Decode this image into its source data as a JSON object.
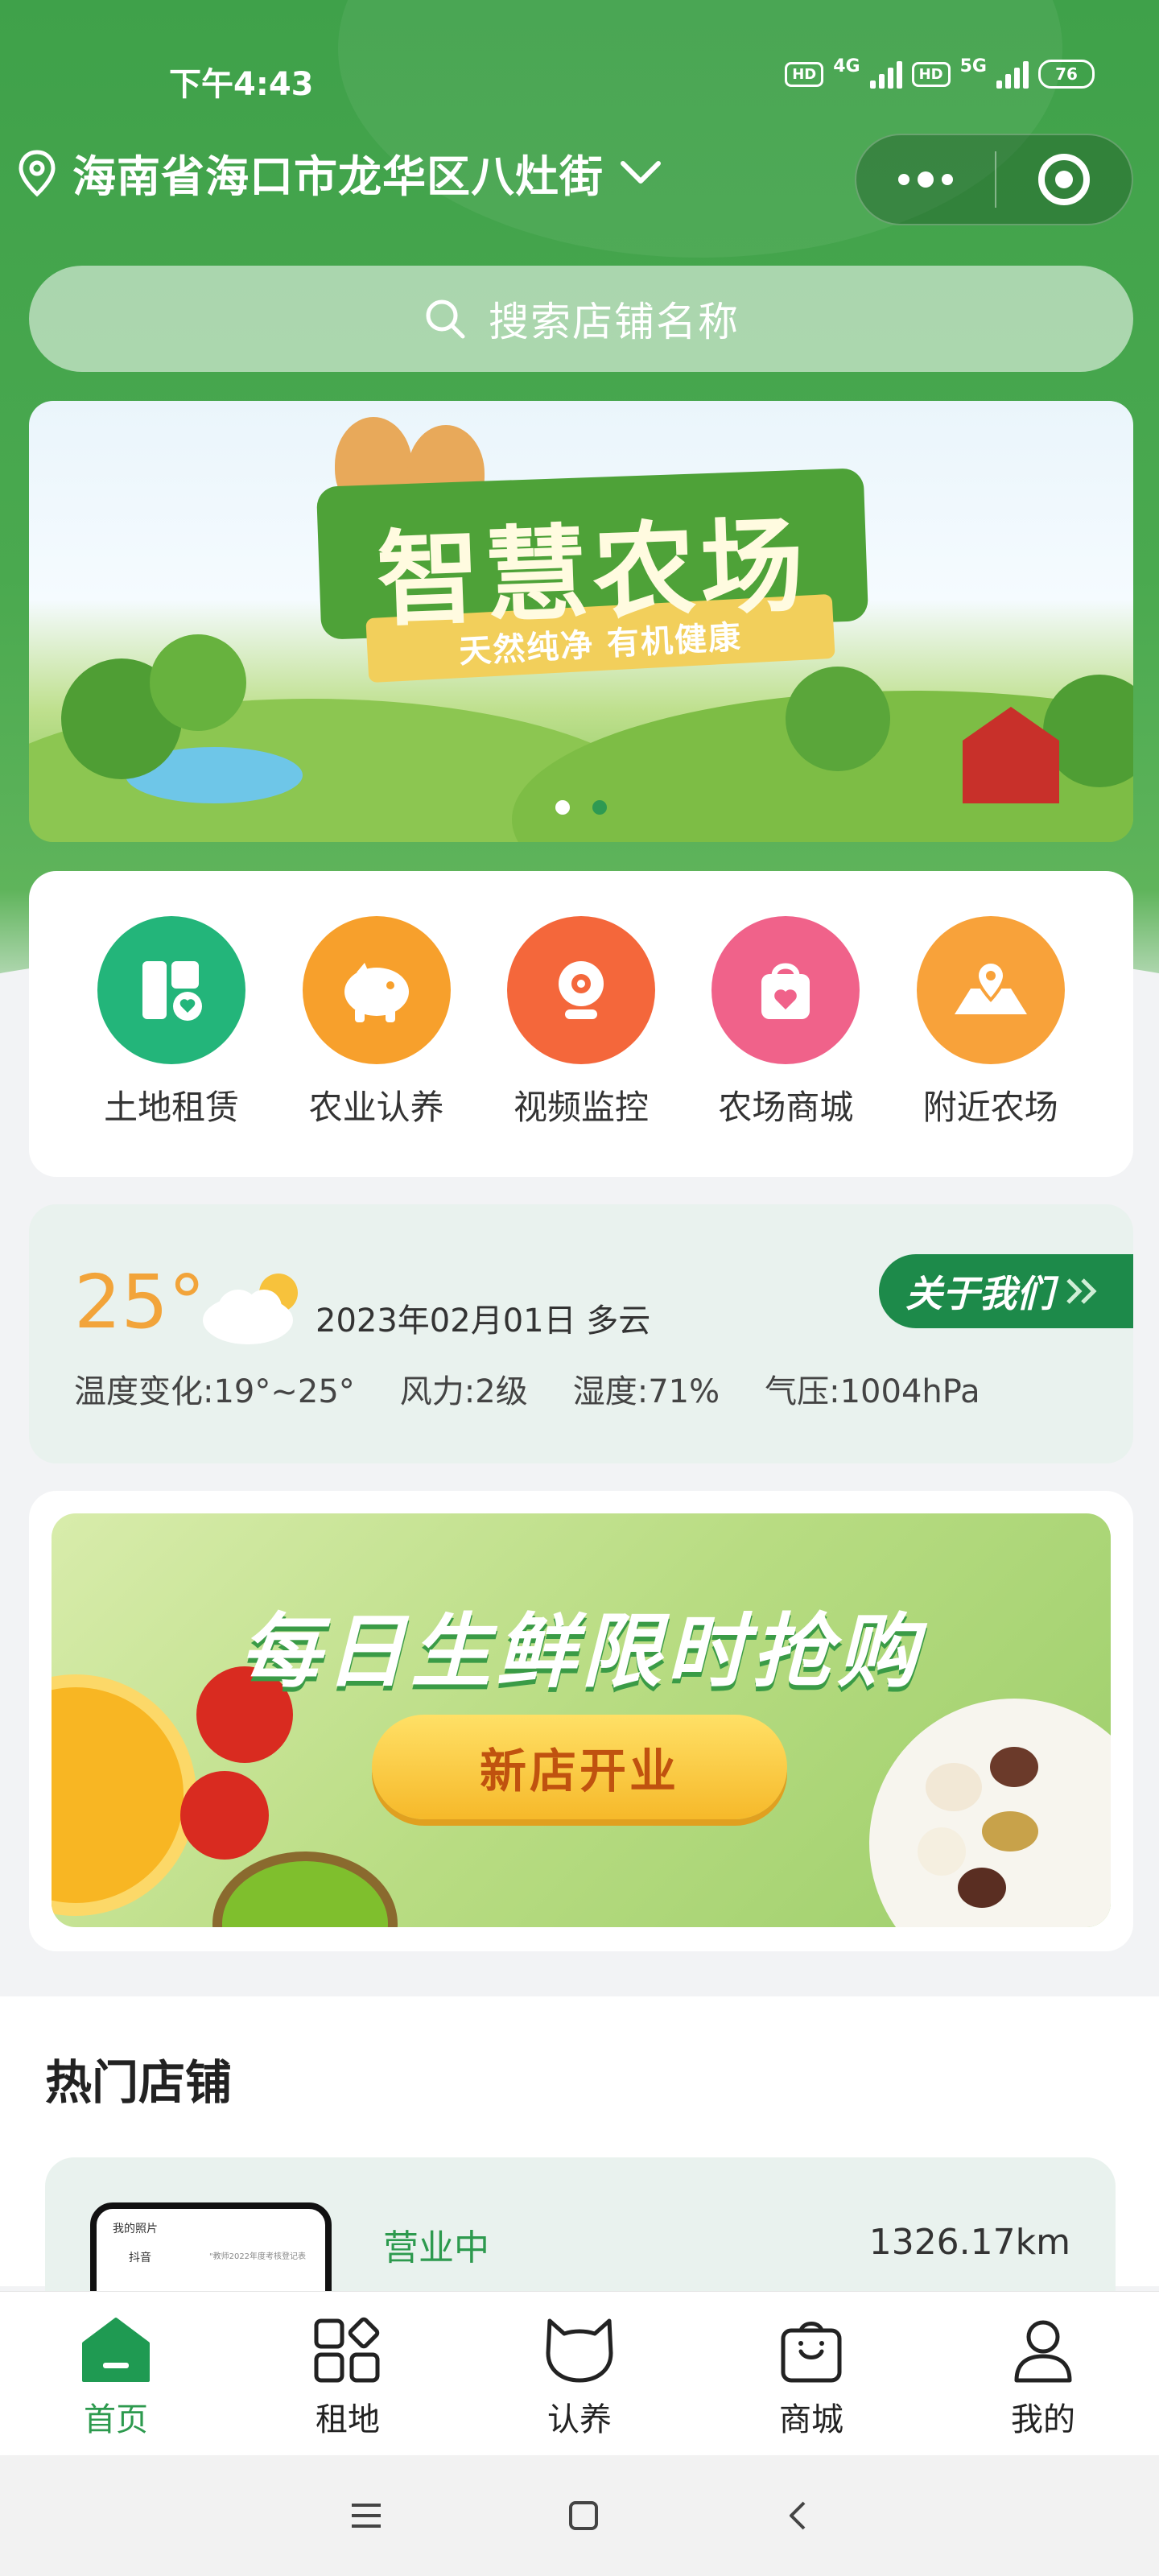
{
  "status_bar": {
    "time": "下午4:43",
    "sim1_badge": "HD",
    "sim1_network": "4G",
    "sim2_badge": "HD",
    "sim2_network": "5G",
    "battery": "76"
  },
  "header": {
    "location": "海南省海口市龙华区八灶街",
    "search_placeholder": "搜索店铺名称"
  },
  "banner": {
    "title": "智慧农场",
    "subtitle": "天然纯净 有机健康",
    "slide_count": 2,
    "active_slide": 2
  },
  "quick_menu": [
    {
      "label": "土地租赁",
      "icon": "land-lease-icon",
      "color": "#23b57a"
    },
    {
      "label": "农业认养",
      "icon": "piggy-icon",
      "color": "#f7a02c"
    },
    {
      "label": "视频监控",
      "icon": "camera-icon",
      "color": "#f4673b"
    },
    {
      "label": "农场商城",
      "icon": "shopping-bag-heart-icon",
      "color": "#f0628a"
    },
    {
      "label": "附近农场",
      "icon": "map-pin-icon",
      "color": "#f8a23a"
    }
  ],
  "weather": {
    "temperature": "25°",
    "date_condition": "2023年02月01日 多云",
    "temp_range": "温度变化:19°~25°",
    "wind": "风力:2级",
    "humidity": "湿度:71%",
    "pressure": "气压:1004hPa",
    "about_label": "关于我们"
  },
  "promo": {
    "title": "每日生鲜限时抢购",
    "button": "新店开业"
  },
  "hot_stores": {
    "title": "热门店铺",
    "stores": [
      {
        "status": "营业中",
        "distance": "1326.17km",
        "thumb_line1": "我的照片",
        "thumb_line2": "抖音",
        "thumb_line3": "\"教师2022年度考核登记表"
      }
    ]
  },
  "tabbar": [
    {
      "label": "首页",
      "icon": "home-icon",
      "active": true
    },
    {
      "label": "租地",
      "icon": "grid-icon",
      "active": false
    },
    {
      "label": "认养",
      "icon": "cat-icon",
      "active": false
    },
    {
      "label": "商城",
      "icon": "bag-icon",
      "active": false
    },
    {
      "label": "我的",
      "icon": "user-icon",
      "active": false
    }
  ],
  "colors": {
    "brand_green": "#3fa14a",
    "accent_green": "#2d9a4e",
    "temp_orange": "#f2a43a"
  }
}
